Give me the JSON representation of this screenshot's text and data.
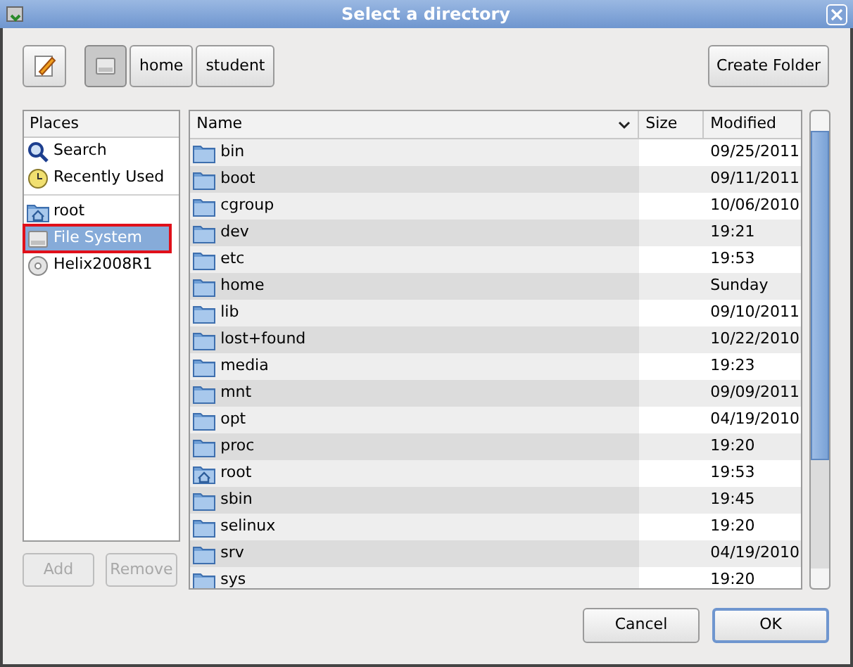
{
  "window": {
    "title": "Select a directory"
  },
  "toolbar": {
    "path": [
      {
        "kind": "drive",
        "selected": true
      },
      {
        "label": "home",
        "selected": false
      },
      {
        "label": "student",
        "selected": false
      }
    ],
    "create_button": "Create Folder"
  },
  "places": {
    "header": "Places",
    "sections": [
      {
        "items": [
          {
            "label": "Search",
            "kind": "search",
            "selected": false,
            "marked": false
          },
          {
            "label": "Recently Used",
            "kind": "recent",
            "selected": false,
            "marked": false
          }
        ]
      },
      {
        "items": [
          {
            "label": "root",
            "kind": "home",
            "selected": false,
            "marked": false
          },
          {
            "label": "File System",
            "kind": "drive",
            "selected": true,
            "marked": true
          },
          {
            "label": "Helix2008R1",
            "kind": "disc",
            "selected": false,
            "marked": false
          }
        ]
      }
    ],
    "buttons": [
      {
        "label": "Add",
        "disabled": true
      },
      {
        "label": "Remove",
        "disabled": true
      }
    ]
  },
  "files": {
    "columns": [
      "Name",
      "Size",
      "Modified"
    ],
    "rows": [
      {
        "name": "bin",
        "kind": "folder",
        "modified": "09/25/2011"
      },
      {
        "name": "boot",
        "kind": "folder",
        "modified": "09/11/2011"
      },
      {
        "name": "cgroup",
        "kind": "folder",
        "modified": "10/06/2010"
      },
      {
        "name": "dev",
        "kind": "folder",
        "modified": "19:21"
      },
      {
        "name": "etc",
        "kind": "folder",
        "modified": "19:53"
      },
      {
        "name": "home",
        "kind": "folder",
        "modified": "Sunday"
      },
      {
        "name": "lib",
        "kind": "folder",
        "modified": "09/10/2011"
      },
      {
        "name": "lost+found",
        "kind": "folder",
        "modified": "10/22/2010"
      },
      {
        "name": "media",
        "kind": "folder",
        "modified": "19:23"
      },
      {
        "name": "mnt",
        "kind": "folder",
        "modified": "09/09/2011"
      },
      {
        "name": "opt",
        "kind": "folder",
        "modified": "04/19/2010"
      },
      {
        "name": "proc",
        "kind": "folder",
        "modified": "19:20"
      },
      {
        "name": "root",
        "kind": "home",
        "modified": "19:53"
      },
      {
        "name": "sbin",
        "kind": "folder",
        "modified": "19:45"
      },
      {
        "name": "selinux",
        "kind": "folder",
        "modified": "19:20"
      },
      {
        "name": "srv",
        "kind": "folder",
        "modified": "04/19/2010"
      },
      {
        "name": "sys",
        "kind": "folder",
        "modified": "19:20"
      }
    ]
  },
  "dialog_buttons": [
    {
      "label": "Cancel",
      "default": false
    },
    {
      "label": "OK",
      "default": true
    }
  ]
}
